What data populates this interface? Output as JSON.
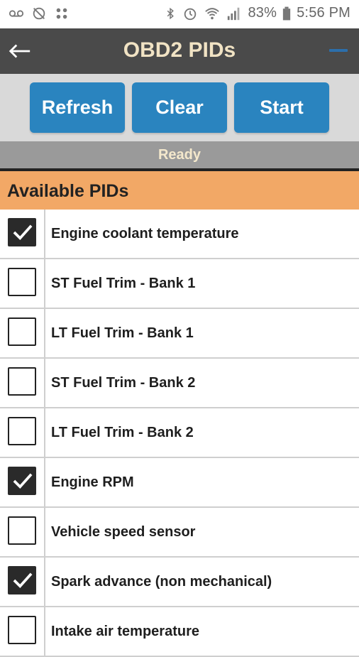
{
  "status_bar": {
    "battery_percent": "83%",
    "time": "5:56 PM",
    "left_icons": [
      "voicemail-icon",
      "no-location-icon",
      "apps-grid-icon"
    ],
    "right_icons": [
      "bluetooth-icon",
      "alarm-icon",
      "wifi-icon",
      "signal-icon",
      "battery-icon"
    ]
  },
  "header": {
    "title": "OBD2 PIDs",
    "back_icon": "arrow-left-icon",
    "menu_icon": "menu-icon"
  },
  "toolbar": {
    "refresh_label": "Refresh",
    "clear_label": "Clear",
    "start_label": "Start"
  },
  "status": {
    "text": "Ready"
  },
  "section": {
    "title": "Available PIDs"
  },
  "pids": [
    {
      "label": "Engine coolant temperature",
      "checked": true
    },
    {
      "label": "ST Fuel Trim - Bank 1",
      "checked": false
    },
    {
      "label": "LT Fuel Trim - Bank 1",
      "checked": false
    },
    {
      "label": "ST Fuel Trim - Bank 2",
      "checked": false
    },
    {
      "label": "LT Fuel Trim - Bank 2",
      "checked": false
    },
    {
      "label": "Engine RPM",
      "checked": true
    },
    {
      "label": "Vehicle speed sensor",
      "checked": false
    },
    {
      "label": "Spark advance (non mechanical)",
      "checked": true
    },
    {
      "label": "Intake air temperature",
      "checked": false
    }
  ],
  "colors": {
    "header_bg": "#4a4a4a",
    "title_text": "#f1e3c4",
    "button_bg": "#2a84bf",
    "section_bg": "#f2a866",
    "status_strip_bg": "#9a9a9a"
  }
}
